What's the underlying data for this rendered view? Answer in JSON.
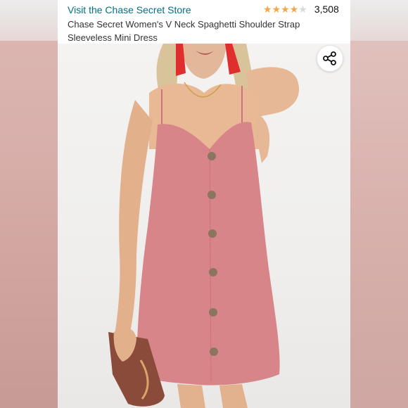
{
  "store": {
    "link_label": "Visit the Chase Secret Store"
  },
  "rating": {
    "stars": 4.0,
    "max": 5,
    "count": "3,508"
  },
  "product": {
    "title": "Chase Secret Women's V Neck Spaghetti Shoulder Strap Sleeveless Mini Dress"
  },
  "share": {
    "icon": "share-icon"
  },
  "colors": {
    "link": "#007185",
    "star": "#f3a847",
    "dress": "#d8858a",
    "clutch": "#8a4b3a"
  }
}
